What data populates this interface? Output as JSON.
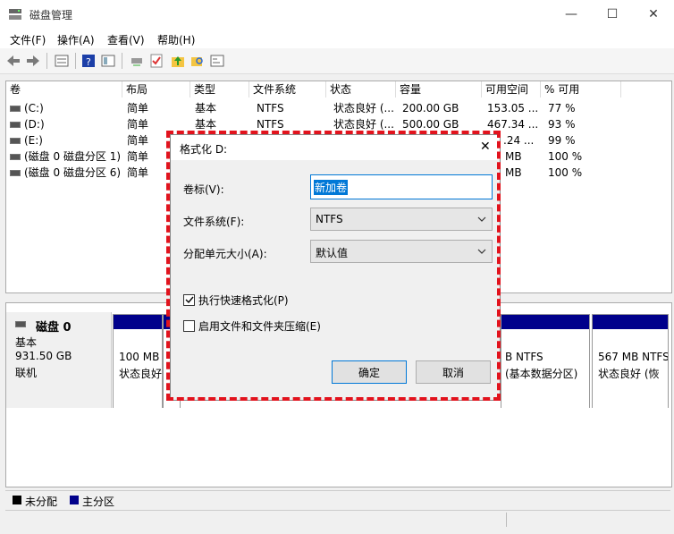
{
  "window": {
    "title": "磁盘管理",
    "minimize": "—",
    "maximize": "☐",
    "close": "✕"
  },
  "menu": [
    "文件(F)",
    "操作(A)",
    "查看(V)",
    "帮助(H)"
  ],
  "volume_list": {
    "headers": [
      "卷",
      "布局",
      "类型",
      "文件系统",
      "状态",
      "容量",
      "可用空间",
      "% 可用"
    ],
    "rows": [
      [
        "(C:)",
        "简单",
        "基本",
        "NTFS",
        "状态良好 (...",
        "200.00 GB",
        "153.05 ...",
        "77 %"
      ],
      [
        "(D:)",
        "简单",
        "基本",
        "NTFS",
        "状态良好 (...",
        "500.00 GB",
        "467.34 ...",
        "93 %"
      ],
      [
        "(E:)",
        "简单",
        "",
        "",
        "",
        "",
        ".24 ...",
        "99 %"
      ],
      [
        "(磁盘 0 磁盘分区 1)",
        "简单",
        "",
        "",
        "",
        "",
        "MB",
        "100 %"
      ],
      [
        "(磁盘 0 磁盘分区 6)",
        "简单",
        "",
        "",
        "",
        "",
        "MB",
        "100 %"
      ]
    ]
  },
  "disk": {
    "name": "磁盘 0",
    "type": "基本",
    "size": "931.50 GB",
    "status": "联机"
  },
  "partitions": [
    {
      "line1": "100 MB",
      "line2": "状态良好"
    },
    {
      "line1": "B NTFS",
      "line2": "(基本数据分区)"
    },
    {
      "line1": "567 MB NTFS",
      "line2": "状态良好 (恢"
    }
  ],
  "legend": [
    {
      "label": "未分配",
      "color": "#000000"
    },
    {
      "label": "主分区",
      "color": "#00008b"
    }
  ],
  "dialog": {
    "title": "格式化 D:",
    "close": "✕",
    "volume_label_label": "卷标(V):",
    "volume_label_value": "新加卷",
    "filesystem_label": "文件系统(F):",
    "filesystem_value": "NTFS",
    "alloc_label": "分配单元大小(A):",
    "alloc_value": "默认值",
    "quick_format_label": "执行快速格式化(P)",
    "quick_format_checked": true,
    "compression_label": "启用文件和文件夹压缩(E)",
    "compression_checked": false,
    "ok": "确定",
    "cancel": "取消",
    "highlight_color": "#e2131d"
  }
}
